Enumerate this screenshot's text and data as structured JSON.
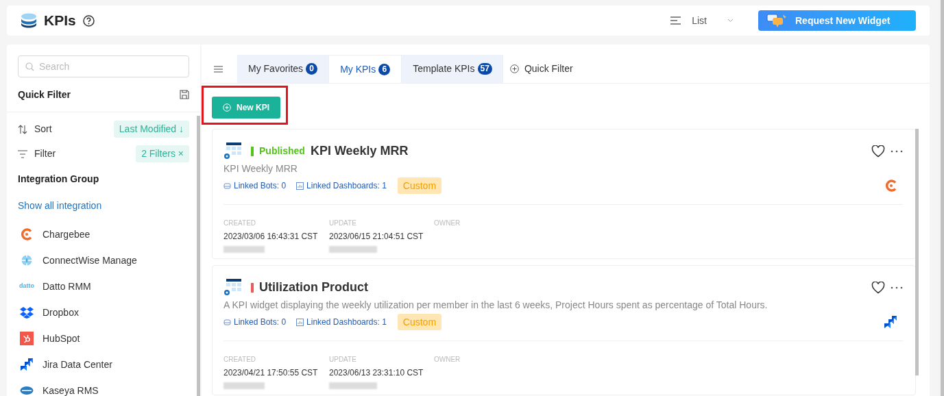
{
  "header": {
    "title": "KPIs",
    "view_label": "List",
    "request_button": "Request New Widget"
  },
  "sidebar": {
    "search": {
      "placeholder": "Search"
    },
    "quick_filter_title": "Quick Filter",
    "sort": {
      "label": "Sort",
      "value": "Last Modified ↓"
    },
    "filter": {
      "label": "Filter",
      "value": "2 Filters ×"
    },
    "integration_group_title": "Integration Group",
    "show_all_link": "Show all integration",
    "integrations": [
      {
        "name": "Chargebee",
        "kind": "chargebee"
      },
      {
        "name": "ConnectWise Manage",
        "kind": "connectwise"
      },
      {
        "name": "Datto RMM",
        "kind": "datto",
        "logo_text": "datto"
      },
      {
        "name": "Dropbox",
        "kind": "dropbox"
      },
      {
        "name": "HubSpot",
        "kind": "hubspot"
      },
      {
        "name": "Jira Data Center",
        "kind": "jira"
      },
      {
        "name": "Kaseya RMS",
        "kind": "kaseya"
      }
    ]
  },
  "tabs": [
    {
      "label": "My Favorites",
      "count": "0",
      "selected": false
    },
    {
      "label": "My KPIs",
      "count": "6",
      "selected": true
    },
    {
      "label": "Template KPIs",
      "count": "57",
      "selected": false
    }
  ],
  "quick_filter_button": "Quick Filter",
  "new_kpi_button": "New KPI",
  "kpis": [
    {
      "status": {
        "kind": "published",
        "label": "Published"
      },
      "title": "KPI Weekly MRR",
      "description": "KPI Weekly MRR",
      "linked_bots": "Linked Bots: 0",
      "linked_dashboards": "Linked Dashboards: 1",
      "tag": "Custom",
      "integration": {
        "kind": "chargebee"
      },
      "created_label": "CREATED",
      "created": "2023/03/06 16:43:31 CST",
      "update_label": "UPDATE",
      "updated": "2023/06/15 21:04:51 CST",
      "owner_label": "OWNER"
    },
    {
      "status": {
        "kind": "draft"
      },
      "title": "Utilization Product",
      "description": "A KPI widget displaying the weekly utilization per member in the last 6 weeks, Project Hours spent as percentage of Total Hours.",
      "linked_bots": "Linked Bots: 0",
      "linked_dashboards": "Linked Dashboards: 1",
      "tag": "Custom",
      "integration": {
        "kind": "jira"
      },
      "created_label": "CREATED",
      "created": "2023/04/21 17:50:55 CST",
      "update_label": "UPDATE",
      "updated": "2023/06/13 23:31:10 CST",
      "owner_label": "OWNER"
    }
  ]
}
